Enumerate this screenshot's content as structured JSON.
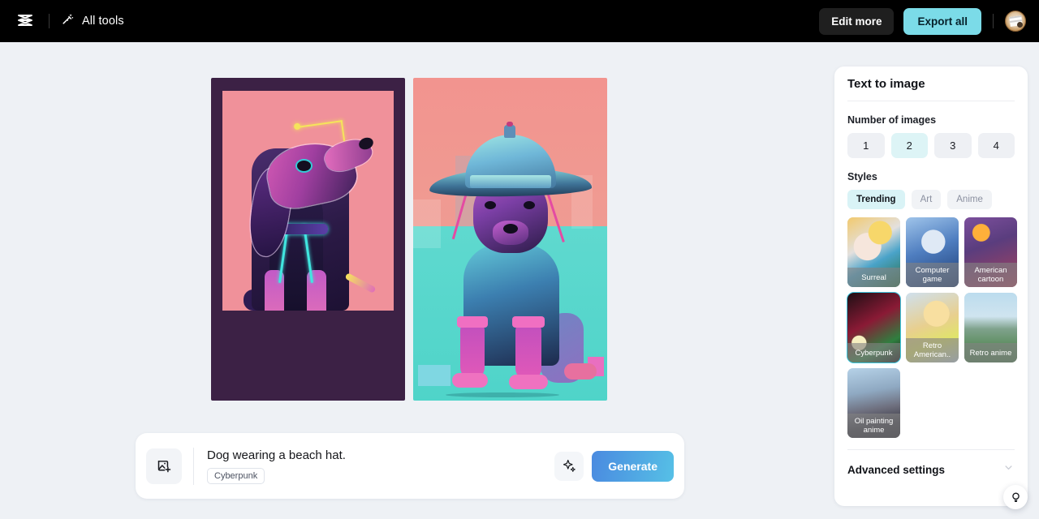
{
  "topbar": {
    "logo_icon": "capcut-logo-icon",
    "all_tools_label": "All tools",
    "all_tools_icon": "magic-wand-icon",
    "edit_more_label": "Edit more",
    "export_all_label": "Export all",
    "avatar_label": "user-avatar",
    "accent_color": "#7bdbe8"
  },
  "results": [
    {
      "alt": "Cyberpunk dog portrait with neon antenna on pink background"
    },
    {
      "alt": "Cyberpunk dog wearing a wide teal helmet hat on peach and teal background"
    }
  ],
  "prompt_bar": {
    "add_image_icon": "add-image-icon",
    "prompt_text": "Dog wearing a beach hat.",
    "style_tag": "Cyberpunk",
    "magic_icon": "sparkle-icon",
    "generate_label": "Generate"
  },
  "panel": {
    "title": "Text to image",
    "number_of_images": {
      "label": "Number of images",
      "options": [
        "1",
        "2",
        "3",
        "4"
      ],
      "selected": "2"
    },
    "styles": {
      "label": "Styles",
      "filters": [
        {
          "label": "Trending",
          "active": true
        },
        {
          "label": "Art",
          "active": false
        },
        {
          "label": "Anime",
          "active": false
        }
      ],
      "tiles": [
        {
          "label": "Surreal",
          "selected": false
        },
        {
          "label": "Computer game",
          "selected": false
        },
        {
          "label": "American cartoon",
          "selected": false
        },
        {
          "label": "Cyberpunk",
          "selected": true
        },
        {
          "label": "Retro American..",
          "selected": false
        },
        {
          "label": "Retro anime",
          "selected": false
        },
        {
          "label": "Oil painting anime",
          "selected": false
        }
      ],
      "selected_color": "#3ec8e0"
    },
    "advanced_settings": {
      "label": "Advanced settings",
      "chevron_icon": "chevron-down-icon"
    }
  },
  "help_fab": {
    "icon": "lightbulb-icon"
  }
}
